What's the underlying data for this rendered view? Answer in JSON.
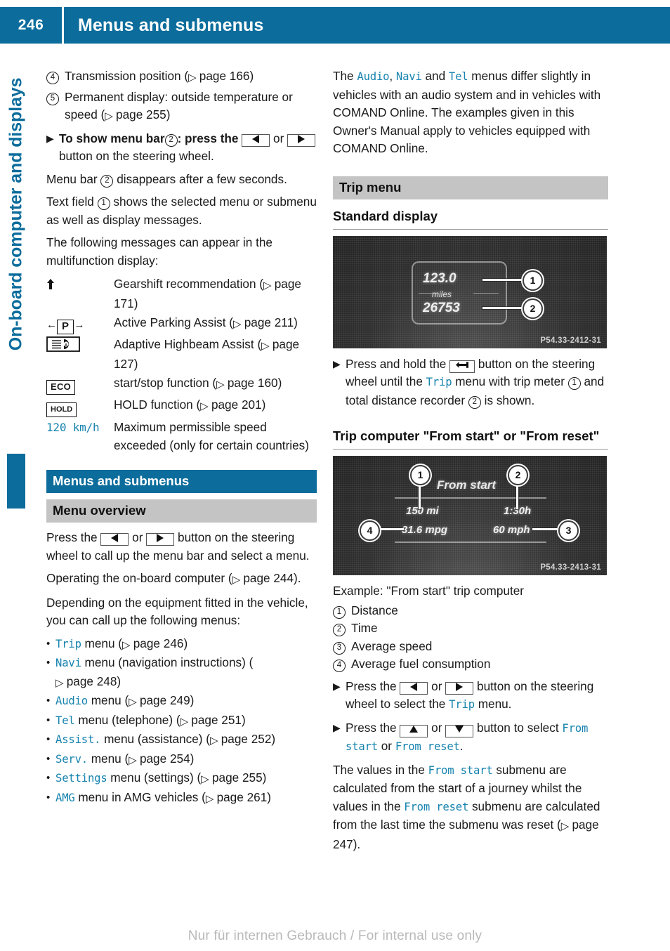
{
  "header": {
    "page_number": "246",
    "title": "Menus and submenus"
  },
  "side_tab": {
    "label": "On-board computer and displays"
  },
  "left_column": {
    "callouts": [
      {
        "mark": "4",
        "text_before": "Transmission position (",
        "page_ref": "page 166",
        "text_after": ")"
      },
      {
        "mark": "5",
        "text_before": "Permanent display: outside temperature or speed (",
        "page_ref": "page 255",
        "text_after": ")"
      }
    ],
    "step_show_menu_bar": {
      "bold_lead": "To show menu bar",
      "mark": "2",
      "after_mark": ": press the",
      "mid": "or",
      "tail": "button on the steering wheel."
    },
    "para_menu_bar": {
      "before": "Menu bar",
      "mark": "2",
      "after": "disappears after a few seconds."
    },
    "para_text_field": {
      "before": "Text field",
      "mark": "1",
      "after": "shows the selected menu or submenu as well as display messages."
    },
    "para_following": "The following messages can appear in the multifunction display:",
    "symbol_table": [
      {
        "symbol": "gearshift-arrow",
        "symbol_text": "",
        "desc": "Gearshift recommendation (",
        "page_ref": "page 171",
        "desc_after": ")"
      },
      {
        "symbol": "parking-assist-p",
        "symbol_text": "P",
        "desc": "Active Parking Assist (",
        "page_ref": "page 211",
        "desc_after": ")"
      },
      {
        "symbol": "highbeam-assist",
        "symbol_text": "",
        "desc": "Adaptive Highbeam Assist (",
        "page_ref": "page 127",
        "desc_after": ")"
      },
      {
        "symbol": "eco-badge",
        "symbol_text": "ECO",
        "desc": "start/stop function (",
        "page_ref": "page 160",
        "desc_after": ")"
      },
      {
        "symbol": "hold-badge",
        "symbol_text": "HOLD",
        "desc": "HOLD function (",
        "page_ref": "page 201",
        "desc_after": ")"
      },
      {
        "symbol": "speed-value",
        "symbol_text": "120 km/h",
        "desc": "Maximum permissible speed exceeded (only for certain countries)",
        "page_ref": "",
        "desc_after": ""
      }
    ],
    "heading_blue": "Menus and submenus",
    "heading_grey": "Menu overview",
    "para_press": {
      "before": "Press the",
      "mid": "or",
      "after": "button on the steering wheel to call up the menu bar and select a menu."
    },
    "para_operating": {
      "text": "Operating the on-board computer (",
      "page_ref": "page 244",
      "after": ")."
    },
    "para_depending": "Depending on the equipment fitted in the vehicle, you can call up the following menus:",
    "menu_list": [
      {
        "mono": "Trip",
        "text": " menu (",
        "page_ref": "page 246",
        "after": ")"
      },
      {
        "mono": "Navi",
        "text": " menu (navigation instructions) (",
        "page_ref": "page 248",
        "after": ")"
      },
      {
        "mono": "Audio",
        "text": " menu (",
        "page_ref": "page 249",
        "after": ")"
      },
      {
        "mono": "Tel",
        "text": " menu (telephone) (",
        "page_ref": "page 251",
        "after": ")"
      },
      {
        "mono": "Assist.",
        "text": " menu (assistance) (",
        "page_ref": "page 252",
        "after": ")"
      },
      {
        "mono": "Serv.",
        "text": " menu (",
        "page_ref": "page 254",
        "after": ")"
      },
      {
        "mono": "Settings",
        "text": " menu (settings) (",
        "page_ref": "page 255",
        "after": ")"
      },
      {
        "mono": "AMG",
        "text": " menu in AMG vehicles (",
        "page_ref": "page 261",
        "after": ")"
      }
    ]
  },
  "right_column": {
    "intro_para": {
      "p1": "The ",
      "m1": "Audio",
      "p2": ", ",
      "m2": "Navi",
      "p3": " and ",
      "m3": "Tel",
      "p4": " menus differ slightly in vehicles with an audio system and in vehicles with COMAND Online. The examples given in this Owner's Manual apply to vehicles equipped with COMAND Online."
    },
    "heading_trip_menu": "Trip menu",
    "heading_standard_display": "Standard display",
    "figure1": {
      "trip_value": "123.0",
      "unit": "miles",
      "total_value": "26753",
      "bubble1": "1",
      "bubble2": "2",
      "caption": "P54.33-2412-31"
    },
    "step_press_hold": {
      "before": "Press and hold the",
      "mid": "button on the steering wheel until the",
      "mono_trip": "Trip",
      "after1": "menu with trip meter",
      "mark1": "1",
      "after2": "and total distance recorder",
      "mark2": "2",
      "after3": "is shown."
    },
    "heading_trip_computer": "Trip computer \"From start\" or \"From reset\"",
    "figure2": {
      "title": "From start",
      "distance": "150 mi",
      "time": "1:30h",
      "consumption": "31.6 mpg",
      "speed": "60 mph",
      "bubble1": "1",
      "bubble2": "2",
      "bubble3": "3",
      "bubble4": "4",
      "caption": "P54.33-2413-31"
    },
    "example_caption": "Example: \"From start\" trip computer",
    "callout_list": [
      {
        "mark": "1",
        "label": "Distance"
      },
      {
        "mark": "2",
        "label": "Time"
      },
      {
        "mark": "3",
        "label": "Average speed"
      },
      {
        "mark": "4",
        "label": "Average fuel consumption"
      }
    ],
    "step_select_trip": {
      "before": "Press the",
      "mid": "or",
      "after": "button on the steering wheel to select the",
      "mono_trip": "Trip",
      "tail": "menu."
    },
    "step_select_from": {
      "before": "Press the",
      "mid": "or",
      "after": "button to select",
      "mono_a": "From start",
      "joiner": "or",
      "mono_b": "From reset",
      "tail": "."
    },
    "para_values": {
      "p1": "The values in the ",
      "m1": "From start",
      "p2": " submenu are calculated from the start of a journey whilst the values in the ",
      "m2": "From reset",
      "p3": " submenu are calculated from the last time the submenu was reset (",
      "page_ref": "page 247",
      "p4": ")."
    }
  },
  "footer": {
    "watermark": "Nur für internen Gebrauch / For internal use only"
  },
  "colors": {
    "brand_blue": "#0c6d9c",
    "mono_blue": "#1683ae",
    "grey_heading": "#c4c4c4"
  }
}
